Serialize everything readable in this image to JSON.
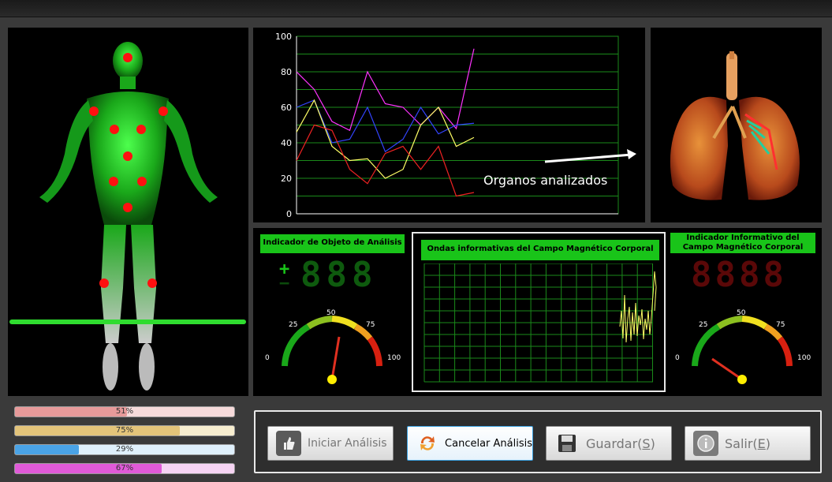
{
  "chart_data": {
    "type": "line",
    "x": [
      1,
      2,
      3,
      4,
      5,
      6,
      7,
      8,
      9,
      10,
      11
    ],
    "ylim": [
      0,
      100
    ],
    "yticks": [
      "0",
      "20",
      "40",
      "60",
      "80",
      "100"
    ],
    "series": [
      {
        "color": "#ff33ff",
        "values": [
          80,
          70,
          52,
          47,
          80,
          62,
          60,
          50,
          60,
          48,
          93
        ]
      },
      {
        "color": "#3344ff",
        "values": [
          60,
          64,
          40,
          42,
          60,
          35,
          42,
          60,
          45,
          50,
          51
        ]
      },
      {
        "color": "#ffff66",
        "values": [
          46,
          64,
          38,
          30,
          31,
          20,
          25,
          50,
          60,
          38,
          43
        ]
      },
      {
        "color": "#ee2222",
        "values": [
          30,
          50,
          47,
          25,
          17,
          34,
          38,
          25,
          38,
          10,
          12
        ]
      }
    ],
    "annotation": "Organos analizados"
  },
  "indicator_object": {
    "label": "Indicador de Objeto de Análisis",
    "plus": "+",
    "minus": "−",
    "digits": "888",
    "gauge": {
      "ticks": [
        "0",
        "25",
        "50",
        "75",
        "100"
      ],
      "value": 55
    }
  },
  "waves": {
    "label": "Ondas informativas del Campo Magnético Corporal"
  },
  "indicator_info": {
    "label": "Indicador Informativo del Campo Magnético Corporal",
    "digits": "8888",
    "gauge": {
      "ticks": [
        "0",
        "25",
        "50",
        "75",
        "100"
      ],
      "value": 20
    }
  },
  "progress_bars": [
    {
      "label": "51%",
      "value": 51,
      "track": "#f6dada",
      "fill": "#e79a9a"
    },
    {
      "label": "75%",
      "value": 75,
      "track": "#f7edcf",
      "fill": "#e3c47a"
    },
    {
      "label": "29%",
      "value": 29,
      "track": "#dff0fb",
      "fill": "#4aa3e6"
    },
    {
      "label": "67%",
      "value": 67,
      "track": "#f6d4f3",
      "fill": "#e05ad8"
    }
  ],
  "buttons": {
    "start": "Iniciar Análisis",
    "cancel": "Cancelar Análisis",
    "save": "Guardar(S)",
    "exit": "Salir(E)"
  }
}
